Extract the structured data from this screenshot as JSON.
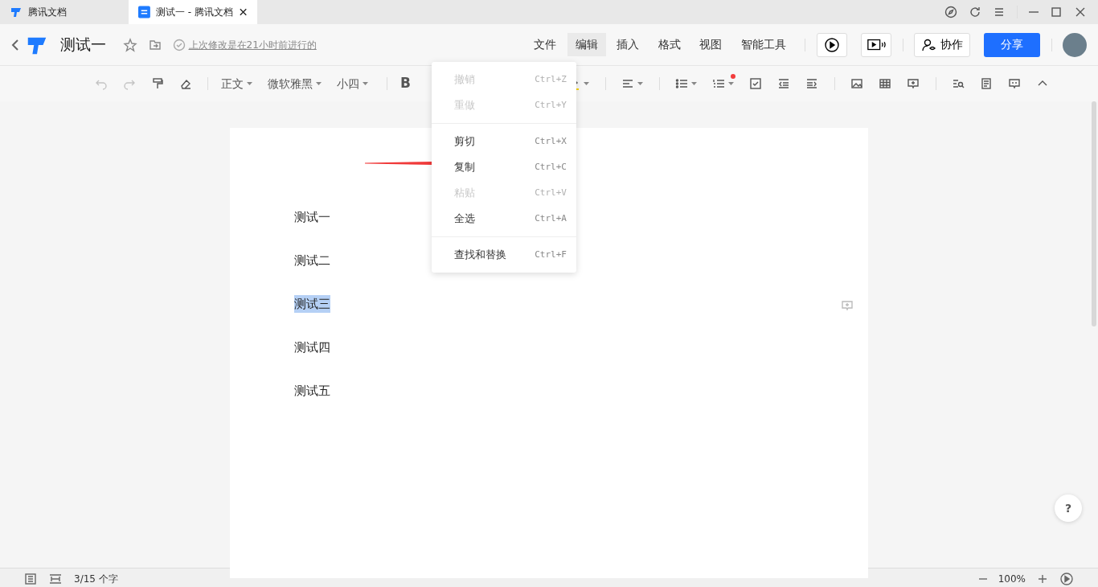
{
  "tabs": [
    {
      "label": "腾讯文档",
      "selected": false,
      "kind": "logo"
    },
    {
      "label": "测试一 - 腾讯文档",
      "selected": true,
      "kind": "doc"
    }
  ],
  "header": {
    "title": "测试一",
    "last_edit": "上次修改是在21小时前进行的",
    "menu": [
      {
        "label": "文件",
        "selected": false
      },
      {
        "label": "编辑",
        "selected": true
      },
      {
        "label": "插入",
        "selected": false
      },
      {
        "label": "格式",
        "selected": false
      },
      {
        "label": "视图",
        "selected": false
      },
      {
        "label": "智能工具",
        "selected": false
      }
    ],
    "collab_button": "协作",
    "share_button": "分享"
  },
  "toolbar": [
    {
      "kind": "undo",
      "disabled": true
    },
    {
      "kind": "redo",
      "disabled": true
    },
    {
      "kind": "painter",
      "disabled": false
    },
    {
      "kind": "eraser",
      "disabled": false
    },
    {
      "kind": "sep"
    },
    {
      "kind": "dropdown",
      "label": "正文"
    },
    {
      "kind": "dropdown",
      "label": "微软雅黑"
    },
    {
      "kind": "dropdown",
      "label": "小四"
    },
    {
      "kind": "sep"
    },
    {
      "kind": "text",
      "label": "B"
    },
    {
      "kind": "gap"
    },
    {
      "kind": "highlight",
      "disabled": false,
      "caret": true
    },
    {
      "kind": "sep"
    },
    {
      "kind": "align",
      "disabled": false,
      "caret": true
    },
    {
      "kind": "sep"
    },
    {
      "kind": "bullets",
      "disabled": false,
      "caret": true
    },
    {
      "kind": "numbers",
      "disabled": false,
      "caret": true,
      "dot": true
    },
    {
      "kind": "checkbox",
      "disabled": false
    },
    {
      "kind": "outdent",
      "disabled": false
    },
    {
      "kind": "indent",
      "disabled": false
    },
    {
      "kind": "sep"
    },
    {
      "kind": "image",
      "disabled": false
    },
    {
      "kind": "table",
      "disabled": false
    },
    {
      "kind": "comment-add",
      "disabled": false
    },
    {
      "kind": "sep"
    },
    {
      "kind": "find",
      "disabled": false
    },
    {
      "kind": "translate",
      "disabled": false
    },
    {
      "kind": "comment",
      "disabled": false
    },
    {
      "kind": "collapse",
      "disabled": false
    }
  ],
  "edit_menu": [
    [
      {
        "label": "撤销",
        "shortcut": "Ctrl+Z",
        "disabled": true
      },
      {
        "label": "重做",
        "shortcut": "Ctrl+Y",
        "disabled": true
      }
    ],
    [
      {
        "label": "剪切",
        "shortcut": "Ctrl+X",
        "disabled": false
      },
      {
        "label": "复制",
        "shortcut": "Ctrl+C",
        "disabled": false
      },
      {
        "label": "粘贴",
        "shortcut": "Ctrl+V",
        "disabled": true
      },
      {
        "label": "全选",
        "shortcut": "Ctrl+A",
        "disabled": false
      }
    ],
    [
      {
        "label": "查找和替换",
        "shortcut": "Ctrl+F",
        "disabled": false
      }
    ]
  ],
  "document": [
    {
      "text": "测试一",
      "selected": false
    },
    {
      "text": "测试二",
      "selected": false
    },
    {
      "text": "测试三",
      "selected": true
    },
    {
      "text": "测试四",
      "selected": false
    },
    {
      "text": "测试五",
      "selected": false
    }
  ],
  "help_button": "?",
  "status_bar": {
    "word_count": "3/15 个字",
    "zoom": "100%"
  }
}
